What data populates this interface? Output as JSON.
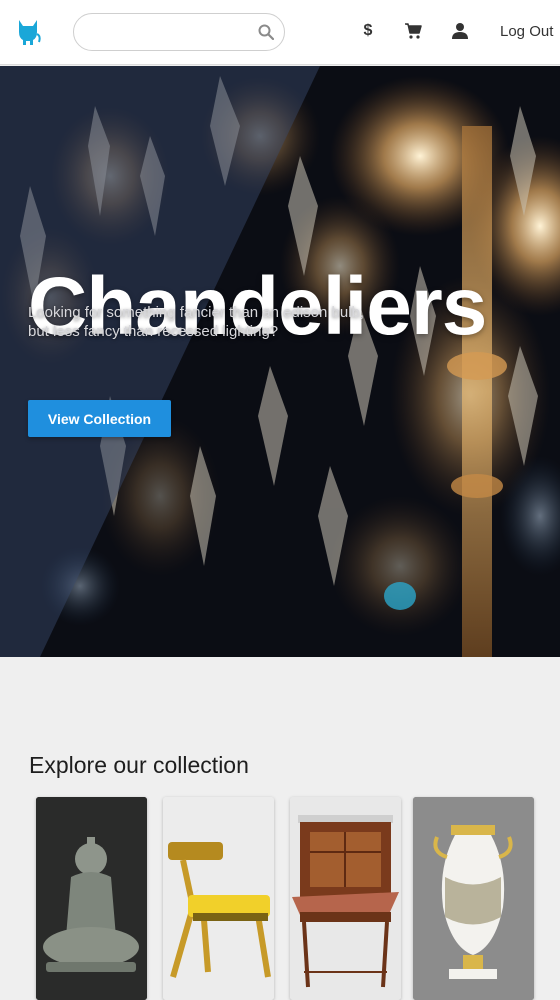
{
  "nav": {
    "search_placeholder": "",
    "search_value": "",
    "currency_label": "$",
    "logout_label": "Log Out",
    "icons": [
      "cat-logo-icon",
      "search-icon",
      "cart-icon",
      "user-icon"
    ],
    "accent_color": "#1aa7d8"
  },
  "hero": {
    "title": "Chandeliers",
    "subtitle": "Looking for something fancier than an edison bulb, but less fancy than recessed lighting?",
    "button_label": "View Collection",
    "button_color": "#1f8fde"
  },
  "collection": {
    "title": "Explore our collection",
    "items": [
      {
        "image": "jade-buddha-statue"
      },
      {
        "image": "yellow-klismos-chair"
      },
      {
        "image": "secretary-desk-cabinet"
      },
      {
        "image": "porcelain-vase"
      }
    ]
  }
}
